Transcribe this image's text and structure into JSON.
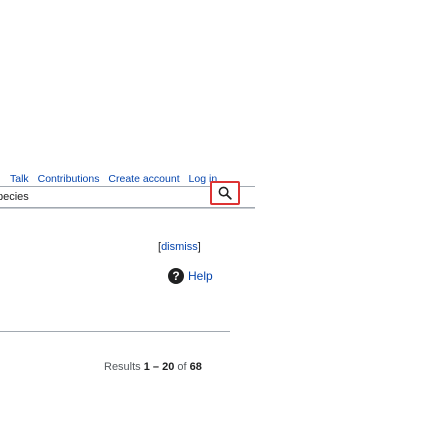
{
  "personal_nav": {
    "items": [
      "Talk",
      "Contributions",
      "Create account",
      "Log in"
    ]
  },
  "search": {
    "value": "pecies",
    "button_icon": "search-icon"
  },
  "notice": {
    "open_bracket": "[",
    "dismiss_label": "dismiss",
    "close_bracket": "]"
  },
  "help": {
    "icon": "help-icon",
    "label": "Help"
  },
  "results": {
    "prefix": "Results ",
    "range": "1 – 20",
    "of": " of ",
    "total": "68"
  },
  "colors": {
    "link": "#0645ad",
    "search_button_border": "#dd3333",
    "text": "#202122"
  }
}
